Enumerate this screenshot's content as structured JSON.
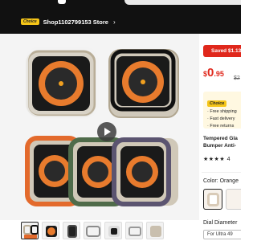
{
  "header": {
    "choice_badge": "Choice",
    "store_name": "Shop1102799153 Store",
    "store_chevron": "chevron-right-icon"
  },
  "gallery": {
    "play_icon": "play-icon",
    "frame_colors": [
      "#c9bfae",
      "#222222",
      "#e36a2c",
      "#4f6b4a",
      "#5b5470",
      "#8c8c8c"
    ]
  },
  "offer": {
    "saved_text": "Saved $1.13",
    "currency": "$",
    "price_int": "0",
    "price_dec": ".95",
    "old_price": "$2",
    "choice_label": "Choice",
    "features": [
      "· Free shipping",
      "· Fast delivery",
      "· Free returns"
    ],
    "title_line1": "Tempered Gla",
    "title_line2": "Bumper Anti-",
    "rating_stars": "★★★★",
    "rating_tail": "4",
    "color_label": "Color: Orange",
    "dial_label": "Dial Diameter",
    "dial_option": "For Ultra 49"
  }
}
